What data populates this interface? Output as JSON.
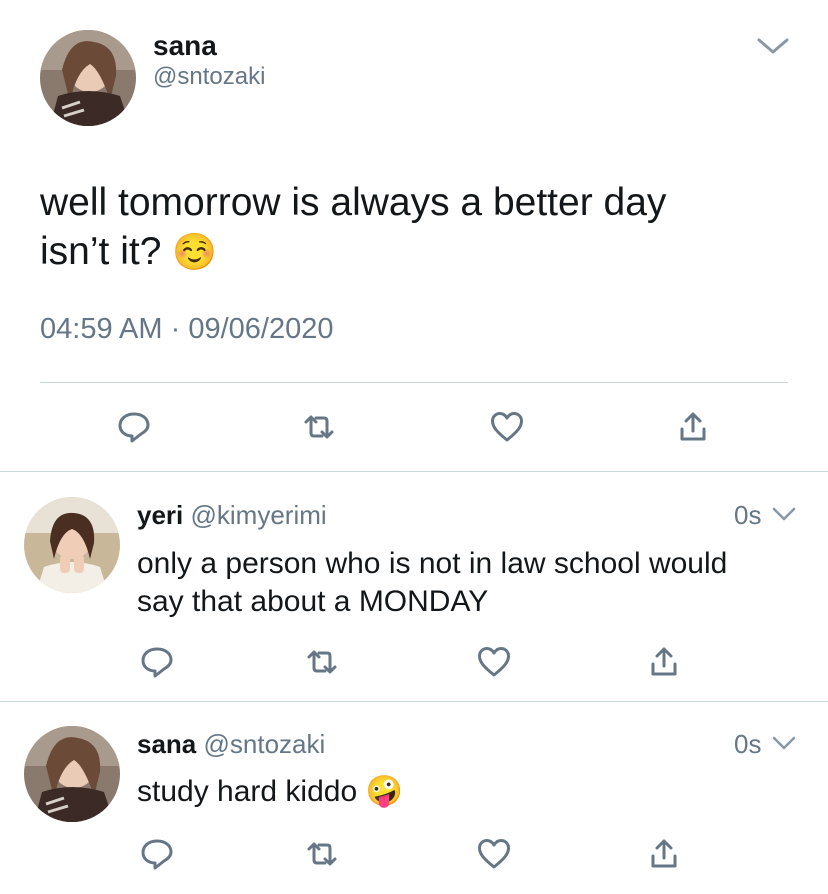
{
  "main_tweet": {
    "display_name": "sana",
    "handle": "@sntozaki",
    "text_line1": "well tomorrow is always a better day",
    "text_line2": "isn’t it?",
    "emoji": "☺️",
    "time": "04:59 AM",
    "separator": "·",
    "date": "09/06/2020"
  },
  "replies": [
    {
      "display_name": "yeri",
      "handle": "@kimyerimi",
      "time_ago": "0s",
      "text_line1": "only a person who is not in law school would",
      "text_line2": "say that about a MONDAY"
    },
    {
      "display_name": "sana",
      "handle": "@sntozaki",
      "time_ago": "0s",
      "text_line1": "study hard kiddo",
      "emoji": "🤪"
    }
  ],
  "icons": {
    "menu": "chevron-down-icon",
    "reply": "reply-icon",
    "retweet": "retweet-icon",
    "like": "heart-icon",
    "share": "share-icon"
  },
  "colors": {
    "text": "#14171a",
    "secondary": "#657786",
    "icon": "#657786",
    "divider": "#ccd6dd"
  }
}
